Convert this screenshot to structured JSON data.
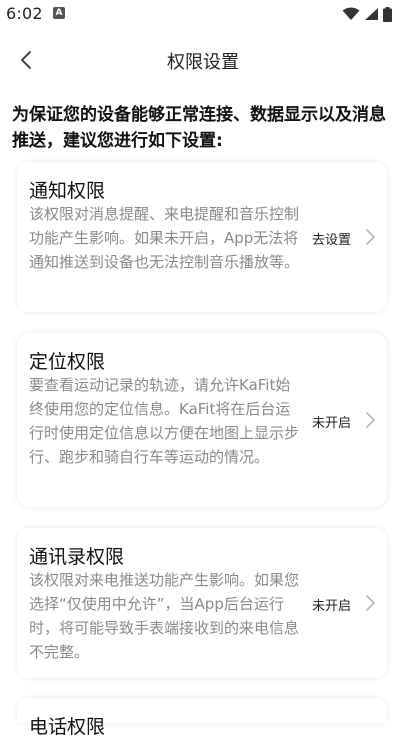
{
  "status_bar": {
    "time": "6:02",
    "notification_icon": "A",
    "icons": [
      "wifi-icon",
      "cellular-signal-icon",
      "battery-icon"
    ]
  },
  "header": {
    "back_icon": "chevron-left-icon",
    "title": "权限设置"
  },
  "intro_text": "为保证您的设备能够正常连接、数据显示以及消息推送，建议您进行如下设置:",
  "permissions": [
    {
      "title": "通知权限",
      "description": "该权限对消息提醒、来电提醒和音乐控制功能产生影响。如果未开启，App无法将通知推送到设备也无法控制音乐播放等。",
      "status": "去设置"
    },
    {
      "title": "定位权限",
      "description": "要查看运动记录的轨迹，请允许KaFit始终使用您的定位信息。KaFit将在后台运行时使用定位信息以方便在地图上显示步行、跑步和骑自行车等运动的情况。",
      "status": "未开启"
    },
    {
      "title": "通讯录权限",
      "description": "该权限对来电推送功能产生影响。如果您选择“仅使用中允许”，当App后台运行时，将可能导致手表端接收到的来电信息不完整。",
      "status": "未开启"
    },
    {
      "title": "电话权限"
    }
  ],
  "colors": {
    "background": "#ffffff",
    "text_primary": "#111111",
    "text_secondary": "#8a8a8a",
    "chevron": "#b5b5b5"
  }
}
